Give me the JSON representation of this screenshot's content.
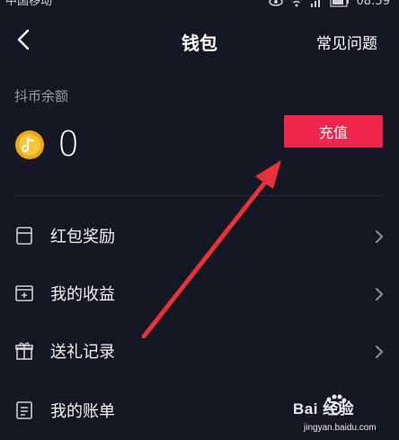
{
  "status_bar": {
    "carrier": "中国移动",
    "time": "08:59"
  },
  "nav": {
    "title": "钱包",
    "faq": "常见问题"
  },
  "balance": {
    "label": "抖币余额",
    "value": "0"
  },
  "recharge_label": "充值",
  "menu": [
    {
      "label": "红包奖励",
      "icon": "red-packet-icon"
    },
    {
      "label": "我的收益",
      "icon": "earnings-icon"
    },
    {
      "label": "送礼记录",
      "icon": "gift-icon"
    },
    {
      "label": "我的账单",
      "icon": "bill-icon"
    }
  ],
  "watermark": {
    "brand": "Bai 经验",
    "url": "jingyan.baidu.com"
  },
  "colors": {
    "background": "#161724",
    "accent": "#f0264f",
    "arrow": "#e8323c"
  }
}
